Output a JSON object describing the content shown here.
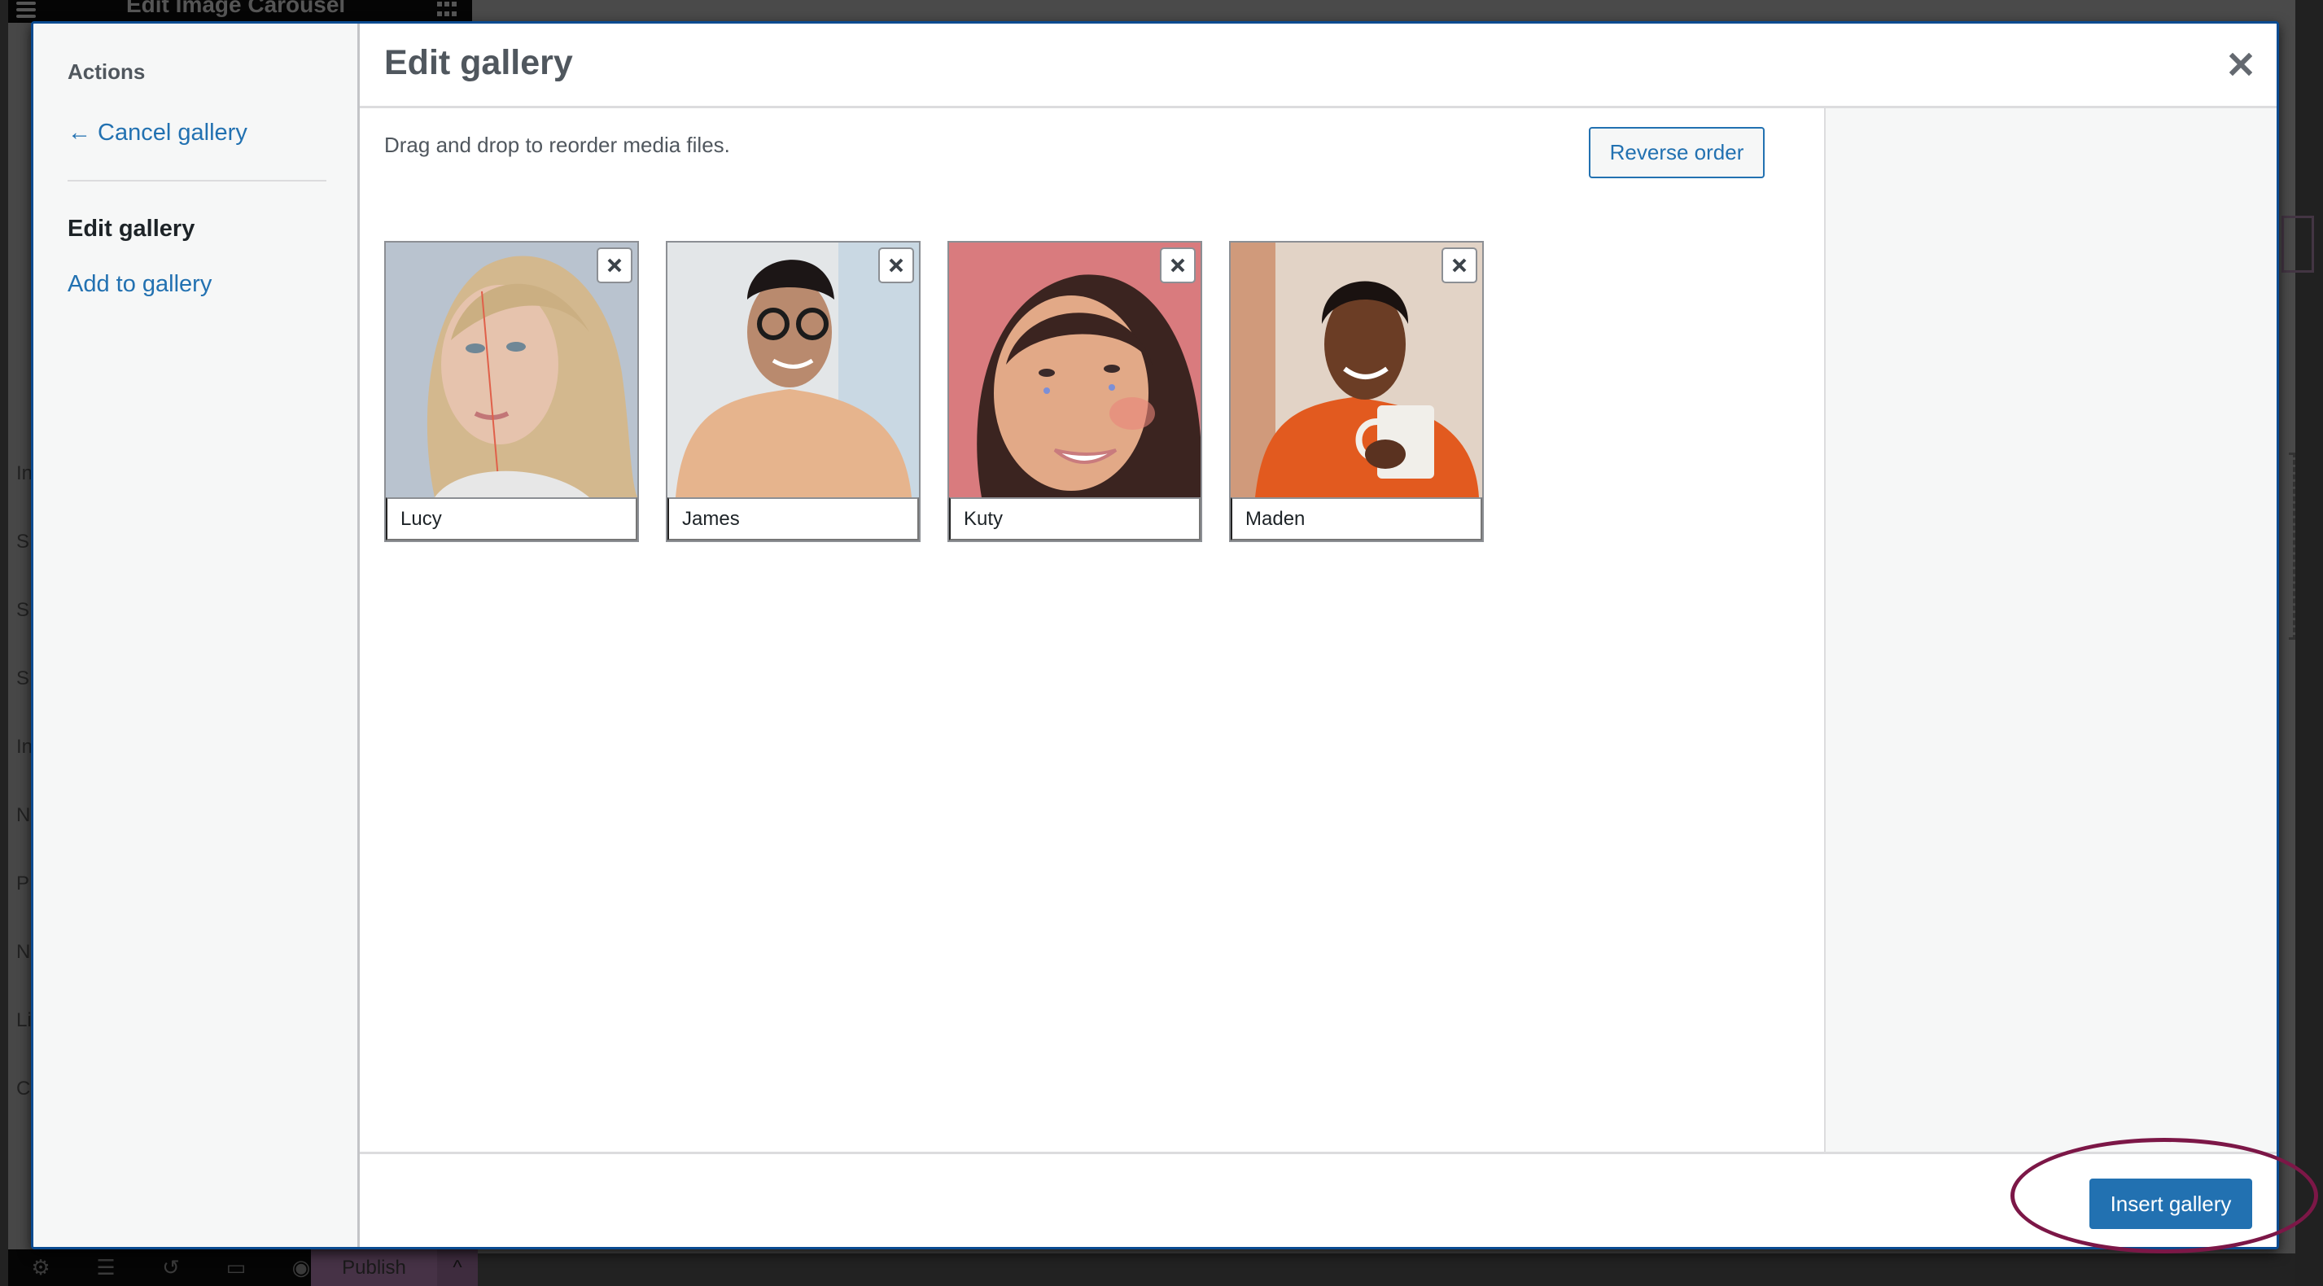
{
  "background": {
    "editor_title": "Edit Image Carousel",
    "side_letters": [
      "In",
      "S",
      "S",
      "S",
      "In",
      "N",
      "P",
      "N",
      "Li",
      "C"
    ],
    "bottom_bar": {
      "icons": [
        "gear-icon",
        "layers-icon",
        "history-icon",
        "responsive-icon",
        "eye-icon"
      ],
      "publish_label": "Publish"
    }
  },
  "modal": {
    "menu": {
      "heading": "Actions",
      "cancel_label": "← Cancel gallery",
      "items": [
        {
          "label": "Edit gallery",
          "active": true
        },
        {
          "label": "Add to gallery",
          "active": false
        }
      ]
    },
    "title": "Edit gallery",
    "instructions": "Drag and drop to reorder media files.",
    "reverse_order_label": "Reverse order",
    "gallery_items": [
      {
        "caption": "Lucy",
        "image": "portrait-blonde-woman",
        "bg": "#b9c3cf"
      },
      {
        "caption": "James",
        "image": "portrait-man-glasses",
        "bg": "#dfe3e6"
      },
      {
        "caption": "Kuty",
        "image": "portrait-woman-pink-bg",
        "bg": "#d97b7e"
      },
      {
        "caption": "Maden",
        "image": "portrait-woman-mug",
        "bg": "#e2d3c6"
      }
    ],
    "insert_label": "Insert gallery"
  },
  "colors": {
    "accent": "#2271b1",
    "annotation": "#7c1747"
  }
}
